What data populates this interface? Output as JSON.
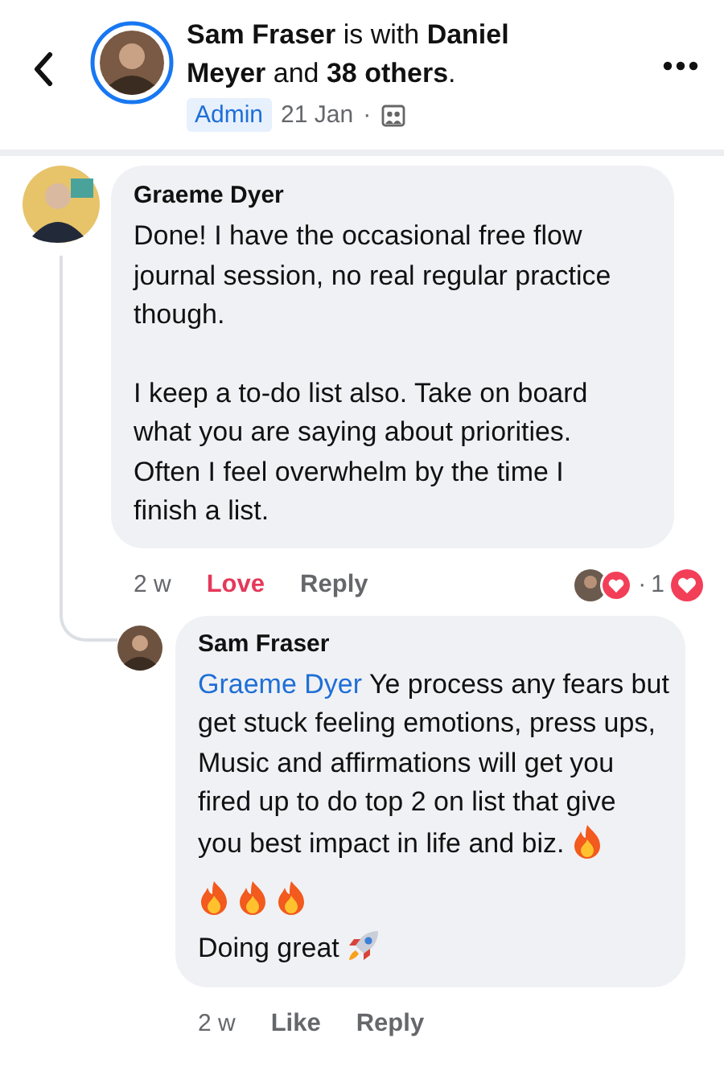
{
  "header": {
    "title": "**Sam Fraser** is with **Daniel Meyer** and **38 others**.",
    "badge": "Admin",
    "date": "21 Jan",
    "separator": "·"
  },
  "comment": {
    "author": "Graeme Dyer",
    "paragraphs": [
      "Done! I have the occasional free flow journal session, no real regular practice though.",
      "I keep a to-do list also. Take on board what you are saying about priorities. Often I feel overwhelm by the time I finish a list."
    ],
    "time": "2 w",
    "actions": [
      {
        "label": "Love",
        "selected": true
      },
      {
        "label": "Reply",
        "selected": false
      }
    ],
    "reactions": {
      "separator": "·",
      "count": "1",
      "loved": true
    }
  },
  "reply": {
    "author": "Sam Fraser",
    "mention": "Graeme Dyer",
    "paragraphs": [
      {
        "kind": "mention-text",
        "text": "Ye process any fears but get stuck feeling emotions, press ups,"
      },
      {
        "kind": "text",
        "text": "Music and affirmations will get you fired up to do top 2 on list that give"
      },
      {
        "kind": "text-fire",
        "text": "you best impact in life and biz."
      },
      {
        "kind": "fire-row"
      },
      {
        "kind": "text-rocket",
        "text": "Doing great"
      }
    ],
    "time": "2 w",
    "actions": [
      {
        "label": "Like",
        "selected": false
      },
      {
        "label": "Reply",
        "selected": false
      }
    ]
  }
}
